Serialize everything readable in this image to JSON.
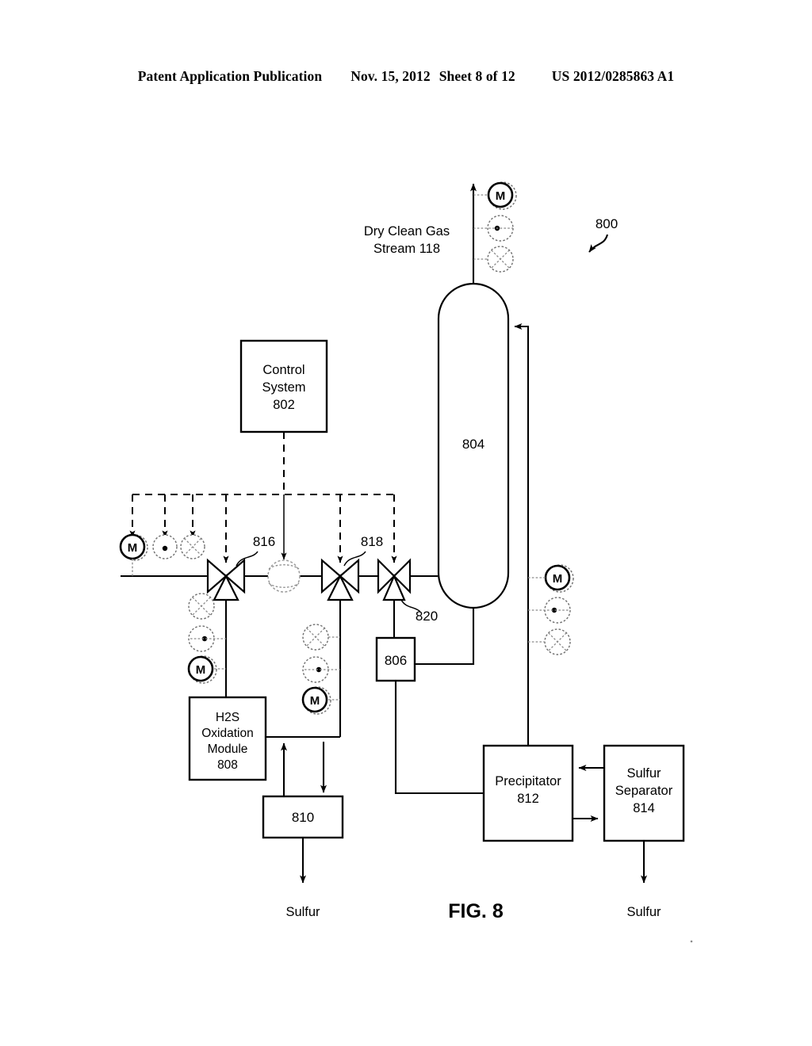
{
  "header": {
    "publication": "Patent Application Publication",
    "date": "Nov. 15, 2012",
    "sheet": "Sheet 8 of 12",
    "number": "US 2012/0285863 A1"
  },
  "figure": {
    "caption": "FIG. 8",
    "system_ref": "800"
  },
  "labels": {
    "gas_stream": "Dry Clean Gas",
    "gas_stream_2": "Stream 118",
    "sulfur_left": "Sulfur",
    "sulfur_right": "Sulfur"
  },
  "blocks": [
    {
      "id": "control-system",
      "line1": "Control",
      "line2": "System",
      "ref": "802"
    },
    {
      "id": "h2s-oxidation-module",
      "line1": "H2S",
      "line2": "Oxidation",
      "line3": "Module",
      "ref": "808"
    },
    {
      "id": "precipitator",
      "line1": "Precipitator",
      "ref": "812"
    },
    {
      "id": "sulfur-separator",
      "line1": "Sulfur",
      "line2": "Separator",
      "ref": "814"
    },
    {
      "id": "vessel",
      "ref": "804"
    },
    {
      "id": "unit-806",
      "ref": "806"
    },
    {
      "id": "unit-810",
      "ref": "810"
    }
  ],
  "valves": [
    {
      "id": "valve-816",
      "ref": "816"
    },
    {
      "id": "valve-818",
      "ref": "818"
    },
    {
      "id": "valve-820",
      "ref": "820"
    }
  ],
  "instruments": {
    "motor_glyph": "M",
    "groups": [
      {
        "id": "gas-outlet-instruments",
        "types": [
          "motor",
          "dot",
          "cross"
        ]
      },
      {
        "id": "inlet-instruments",
        "types": [
          "motor",
          "dot",
          "cross"
        ]
      },
      {
        "id": "h2s-branch-instruments",
        "types": [
          "cross",
          "dot",
          "motor"
        ]
      },
      {
        "id": "recycle-branch-instruments",
        "types": [
          "cross",
          "dot",
          "motor"
        ]
      },
      {
        "id": "vessel-return-instruments",
        "types": [
          "motor",
          "dot",
          "cross"
        ]
      }
    ]
  }
}
